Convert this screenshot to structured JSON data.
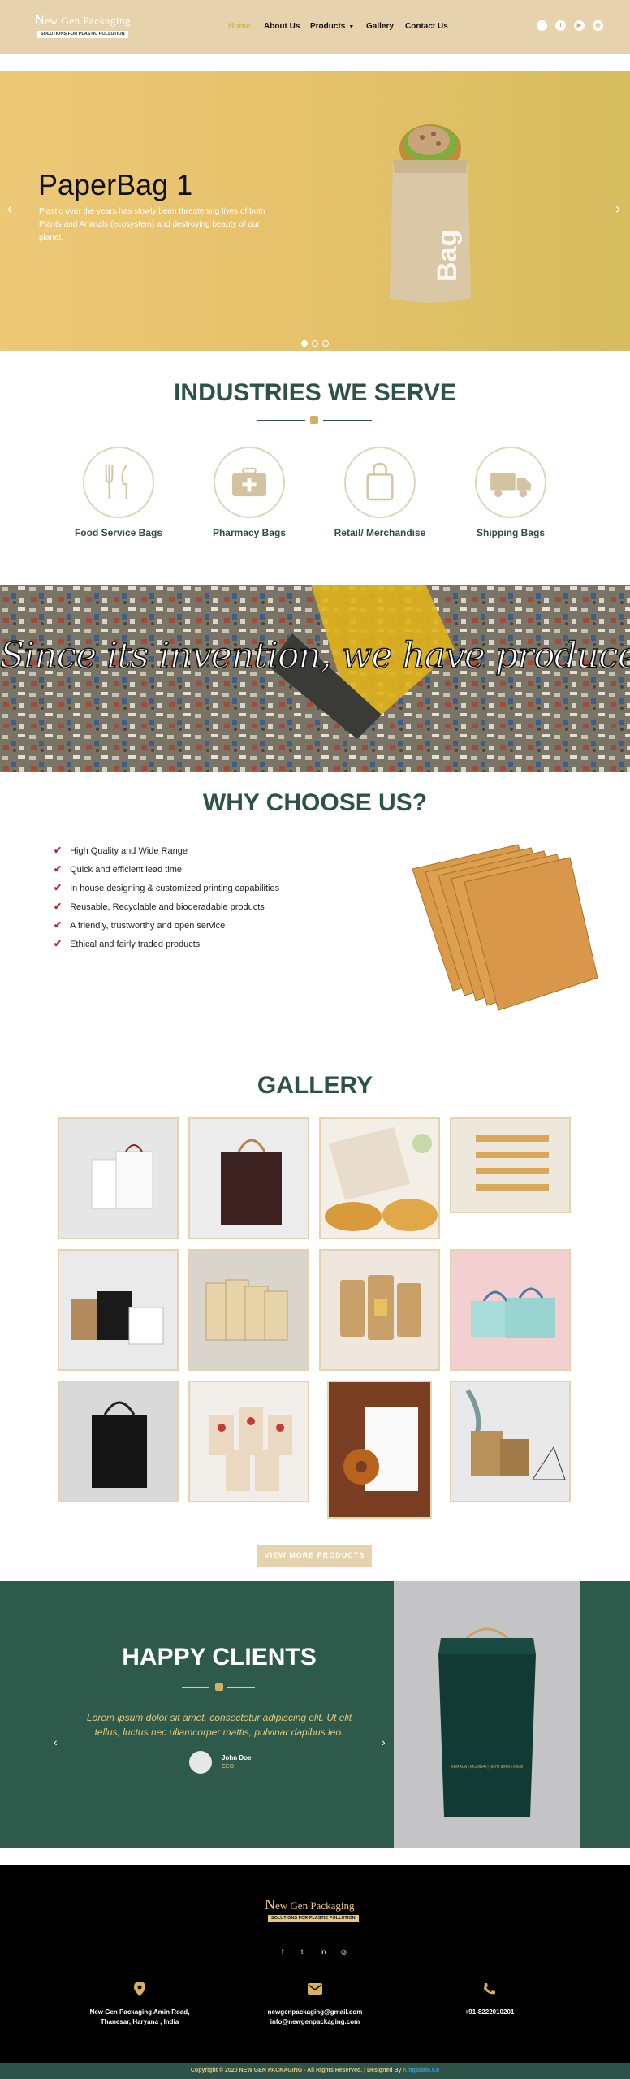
{
  "header": {
    "logo_name_first": "N",
    "logo_name_rest": "ew Gen Packaging",
    "logo_tagline": "SOLUTIONS FOR PLASTIC POLLUTION",
    "nav": [
      "Home",
      "About Us",
      "Products",
      "Gallery",
      "Contact Us"
    ],
    "social_icons": [
      "facebook-icon",
      "twitter-icon",
      "youtube-icon",
      "instagram-icon"
    ]
  },
  "hero": {
    "title": "PaperBag 1",
    "text": "Plastic over the years has slowly been threatening lives of both Plants and Animals (ecosystem) and destroying beauty of our planet.",
    "bag_print": "Bag",
    "slide_count": 3,
    "active_slide": 1
  },
  "industries": {
    "title": "INDUSTRIES WE SERVE",
    "items": [
      {
        "label": "Food Service Bags",
        "icon": "cutlery-icon"
      },
      {
        "label": "Pharmacy Bags",
        "icon": "first-aid-kit-icon"
      },
      {
        "label": "Retail/ Merchandise",
        "icon": "shopping-bag-icon"
      },
      {
        "label": "Shipping Bags",
        "icon": "truck-icon"
      }
    ]
  },
  "banner": {
    "text": "Since its invention, we have produced"
  },
  "why": {
    "title": "WHY CHOOSE US?",
    "features": [
      "High Quality and Wide Range",
      "Quick and efficient lead time",
      "In house designing & customized printing capabilities",
      "Reusable, Recyclable and bioderadable products",
      "A friendly, trustworthy and open service",
      "Ethical and fairly traded products"
    ]
  },
  "gallery": {
    "title": "GALLERY",
    "button": "VIEW MORE PRODUCTS"
  },
  "clients": {
    "title": "HAPPY CLIENTS",
    "quote": "Lorem ipsum dolor sit amet, consectetur adipiscing elit. Ut elit tellus, luctus nec ullamcorper mattis, pulvinar dapibus leo.",
    "name": "John Doe",
    "role": "CEO",
    "bag_print": "KERALA | MUMBAI | MOTHERS HOME"
  },
  "footer": {
    "logo_name_first": "N",
    "logo_name_rest": "ew Gen Packaging",
    "logo_tagline": "SOLUTIONS FOR PLASTIC POLLUTION",
    "address": [
      "New Gen Packaging Amin Road,",
      "Thanesar, Haryana , India"
    ],
    "emails": [
      "newgenpackaging@gmail.com",
      "info@newgenpackaging.com"
    ],
    "phone": "+91-8222010201",
    "copyright": "Copyright © 2020 NEW GEN PACKAGING - All Rights Reserved. | Designed By",
    "credit": "Kingsdale.Co"
  }
}
